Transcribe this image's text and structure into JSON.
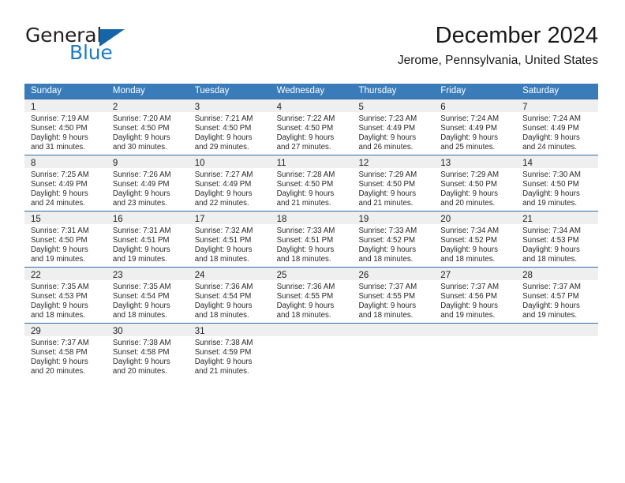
{
  "brand": {
    "name_part1": "General",
    "name_part2": "Blue",
    "triangle_color": "#1565a8",
    "blue_color": "#1f7ac4"
  },
  "header": {
    "title": "December 2024",
    "subtitle": "Jerome, Pennsylvania, United States"
  },
  "theme": {
    "header_row_bg": "#3a7cba",
    "daynum_band_bg": "#efefef",
    "week_separator": "#2f6da8"
  },
  "weekdays": [
    "Sunday",
    "Monday",
    "Tuesday",
    "Wednesday",
    "Thursday",
    "Friday",
    "Saturday"
  ],
  "weeks": [
    [
      {
        "day": "1",
        "sunrise": "Sunrise: 7:19 AM",
        "sunset": "Sunset: 4:50 PM",
        "daylight_line1": "Daylight: 9 hours",
        "daylight_line2": "and 31 minutes."
      },
      {
        "day": "2",
        "sunrise": "Sunrise: 7:20 AM",
        "sunset": "Sunset: 4:50 PM",
        "daylight_line1": "Daylight: 9 hours",
        "daylight_line2": "and 30 minutes."
      },
      {
        "day": "3",
        "sunrise": "Sunrise: 7:21 AM",
        "sunset": "Sunset: 4:50 PM",
        "daylight_line1": "Daylight: 9 hours",
        "daylight_line2": "and 29 minutes."
      },
      {
        "day": "4",
        "sunrise": "Sunrise: 7:22 AM",
        "sunset": "Sunset: 4:50 PM",
        "daylight_line1": "Daylight: 9 hours",
        "daylight_line2": "and 27 minutes."
      },
      {
        "day": "5",
        "sunrise": "Sunrise: 7:23 AM",
        "sunset": "Sunset: 4:49 PM",
        "daylight_line1": "Daylight: 9 hours",
        "daylight_line2": "and 26 minutes."
      },
      {
        "day": "6",
        "sunrise": "Sunrise: 7:24 AM",
        "sunset": "Sunset: 4:49 PM",
        "daylight_line1": "Daylight: 9 hours",
        "daylight_line2": "and 25 minutes."
      },
      {
        "day": "7",
        "sunrise": "Sunrise: 7:24 AM",
        "sunset": "Sunset: 4:49 PM",
        "daylight_line1": "Daylight: 9 hours",
        "daylight_line2": "and 24 minutes."
      }
    ],
    [
      {
        "day": "8",
        "sunrise": "Sunrise: 7:25 AM",
        "sunset": "Sunset: 4:49 PM",
        "daylight_line1": "Daylight: 9 hours",
        "daylight_line2": "and 24 minutes."
      },
      {
        "day": "9",
        "sunrise": "Sunrise: 7:26 AM",
        "sunset": "Sunset: 4:49 PM",
        "daylight_line1": "Daylight: 9 hours",
        "daylight_line2": "and 23 minutes."
      },
      {
        "day": "10",
        "sunrise": "Sunrise: 7:27 AM",
        "sunset": "Sunset: 4:49 PM",
        "daylight_line1": "Daylight: 9 hours",
        "daylight_line2": "and 22 minutes."
      },
      {
        "day": "11",
        "sunrise": "Sunrise: 7:28 AM",
        "sunset": "Sunset: 4:50 PM",
        "daylight_line1": "Daylight: 9 hours",
        "daylight_line2": "and 21 minutes."
      },
      {
        "day": "12",
        "sunrise": "Sunrise: 7:29 AM",
        "sunset": "Sunset: 4:50 PM",
        "daylight_line1": "Daylight: 9 hours",
        "daylight_line2": "and 21 minutes."
      },
      {
        "day": "13",
        "sunrise": "Sunrise: 7:29 AM",
        "sunset": "Sunset: 4:50 PM",
        "daylight_line1": "Daylight: 9 hours",
        "daylight_line2": "and 20 minutes."
      },
      {
        "day": "14",
        "sunrise": "Sunrise: 7:30 AM",
        "sunset": "Sunset: 4:50 PM",
        "daylight_line1": "Daylight: 9 hours",
        "daylight_line2": "and 19 minutes."
      }
    ],
    [
      {
        "day": "15",
        "sunrise": "Sunrise: 7:31 AM",
        "sunset": "Sunset: 4:50 PM",
        "daylight_line1": "Daylight: 9 hours",
        "daylight_line2": "and 19 minutes."
      },
      {
        "day": "16",
        "sunrise": "Sunrise: 7:31 AM",
        "sunset": "Sunset: 4:51 PM",
        "daylight_line1": "Daylight: 9 hours",
        "daylight_line2": "and 19 minutes."
      },
      {
        "day": "17",
        "sunrise": "Sunrise: 7:32 AM",
        "sunset": "Sunset: 4:51 PM",
        "daylight_line1": "Daylight: 9 hours",
        "daylight_line2": "and 18 minutes."
      },
      {
        "day": "18",
        "sunrise": "Sunrise: 7:33 AM",
        "sunset": "Sunset: 4:51 PM",
        "daylight_line1": "Daylight: 9 hours",
        "daylight_line2": "and 18 minutes."
      },
      {
        "day": "19",
        "sunrise": "Sunrise: 7:33 AM",
        "sunset": "Sunset: 4:52 PM",
        "daylight_line1": "Daylight: 9 hours",
        "daylight_line2": "and 18 minutes."
      },
      {
        "day": "20",
        "sunrise": "Sunrise: 7:34 AM",
        "sunset": "Sunset: 4:52 PM",
        "daylight_line1": "Daylight: 9 hours",
        "daylight_line2": "and 18 minutes."
      },
      {
        "day": "21",
        "sunrise": "Sunrise: 7:34 AM",
        "sunset": "Sunset: 4:53 PM",
        "daylight_line1": "Daylight: 9 hours",
        "daylight_line2": "and 18 minutes."
      }
    ],
    [
      {
        "day": "22",
        "sunrise": "Sunrise: 7:35 AM",
        "sunset": "Sunset: 4:53 PM",
        "daylight_line1": "Daylight: 9 hours",
        "daylight_line2": "and 18 minutes."
      },
      {
        "day": "23",
        "sunrise": "Sunrise: 7:35 AM",
        "sunset": "Sunset: 4:54 PM",
        "daylight_line1": "Daylight: 9 hours",
        "daylight_line2": "and 18 minutes."
      },
      {
        "day": "24",
        "sunrise": "Sunrise: 7:36 AM",
        "sunset": "Sunset: 4:54 PM",
        "daylight_line1": "Daylight: 9 hours",
        "daylight_line2": "and 18 minutes."
      },
      {
        "day": "25",
        "sunrise": "Sunrise: 7:36 AM",
        "sunset": "Sunset: 4:55 PM",
        "daylight_line1": "Daylight: 9 hours",
        "daylight_line2": "and 18 minutes."
      },
      {
        "day": "26",
        "sunrise": "Sunrise: 7:37 AM",
        "sunset": "Sunset: 4:55 PM",
        "daylight_line1": "Daylight: 9 hours",
        "daylight_line2": "and 18 minutes."
      },
      {
        "day": "27",
        "sunrise": "Sunrise: 7:37 AM",
        "sunset": "Sunset: 4:56 PM",
        "daylight_line1": "Daylight: 9 hours",
        "daylight_line2": "and 19 minutes."
      },
      {
        "day": "28",
        "sunrise": "Sunrise: 7:37 AM",
        "sunset": "Sunset: 4:57 PM",
        "daylight_line1": "Daylight: 9 hours",
        "daylight_line2": "and 19 minutes."
      }
    ],
    [
      {
        "day": "29",
        "sunrise": "Sunrise: 7:37 AM",
        "sunset": "Sunset: 4:58 PM",
        "daylight_line1": "Daylight: 9 hours",
        "daylight_line2": "and 20 minutes."
      },
      {
        "day": "30",
        "sunrise": "Sunrise: 7:38 AM",
        "sunset": "Sunset: 4:58 PM",
        "daylight_line1": "Daylight: 9 hours",
        "daylight_line2": "and 20 minutes."
      },
      {
        "day": "31",
        "sunrise": "Sunrise: 7:38 AM",
        "sunset": "Sunset: 4:59 PM",
        "daylight_line1": "Daylight: 9 hours",
        "daylight_line2": "and 21 minutes."
      },
      {
        "day": "",
        "sunrise": "",
        "sunset": "",
        "daylight_line1": "",
        "daylight_line2": ""
      },
      {
        "day": "",
        "sunrise": "",
        "sunset": "",
        "daylight_line1": "",
        "daylight_line2": ""
      },
      {
        "day": "",
        "sunrise": "",
        "sunset": "",
        "daylight_line1": "",
        "daylight_line2": ""
      },
      {
        "day": "",
        "sunrise": "",
        "sunset": "",
        "daylight_line1": "",
        "daylight_line2": ""
      }
    ]
  ]
}
